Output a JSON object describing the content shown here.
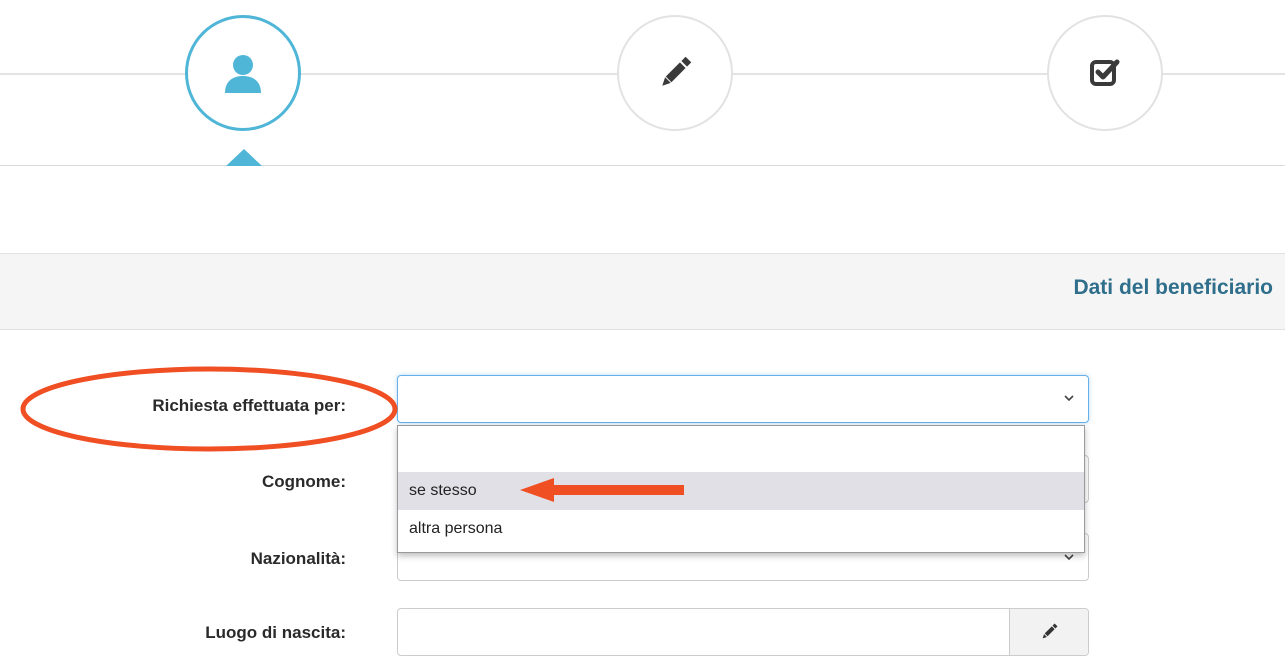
{
  "wizard": {
    "steps": [
      {
        "icon": "user-icon",
        "state": "active"
      },
      {
        "icon": "pencil-icon",
        "state": "inactive"
      },
      {
        "icon": "check-square-icon",
        "state": "inactive"
      }
    ],
    "accent_color": "#4fb6d8"
  },
  "panel": {
    "title": "Dati del beneficiario"
  },
  "form": {
    "richiesta": {
      "label": "Richiesta effettuata per:",
      "value": "",
      "options": [
        "",
        "se stesso",
        "altra persona"
      ],
      "highlighted_option": "se stesso"
    },
    "cognome": {
      "label": "Cognome:",
      "value": ""
    },
    "nazionalita": {
      "label": "Nazionalità:",
      "value": ""
    },
    "luogo_nascita": {
      "label": "Luogo di nascita:",
      "value": "",
      "addon_icon": "pencil-icon"
    }
  },
  "annotations": {
    "color": "#f04e23"
  }
}
